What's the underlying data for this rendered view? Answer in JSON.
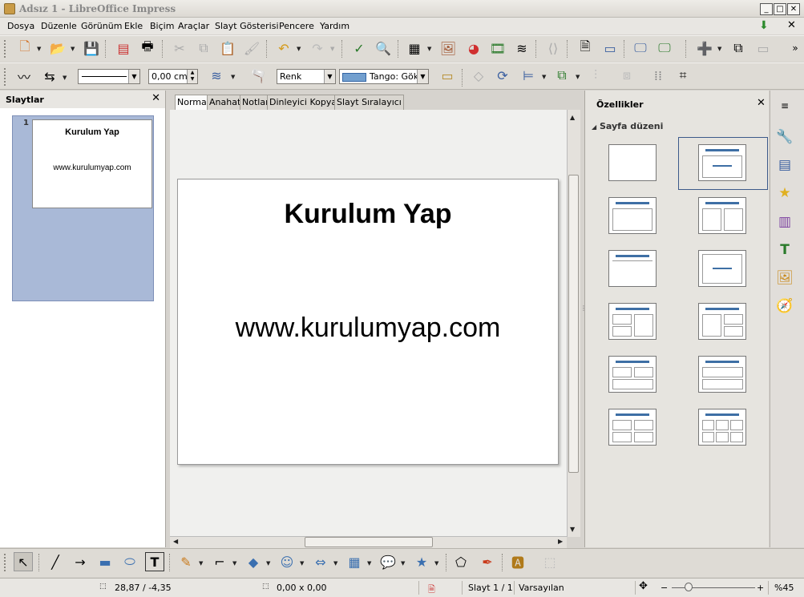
{
  "window": {
    "title": "Adsız 1 - LibreOffice Impress",
    "minimize": "_",
    "maximize": "□",
    "close": "✕"
  },
  "menu": [
    {
      "label": "Dosya"
    },
    {
      "label": "Düzenle"
    },
    {
      "label": "Görünüm"
    },
    {
      "label": "Ekle"
    },
    {
      "label": "Biçim"
    },
    {
      "label": "Araçlar"
    },
    {
      "label": "Slayt Gösterisi"
    },
    {
      "label": "Pencere"
    },
    {
      "label": "Yardım"
    }
  ],
  "menu_close": "✕",
  "format": {
    "line_width": "0,00 cm",
    "area_style": "Renk",
    "fill_color": "Tango: Gök",
    "fill_color_hex": "#729fcf"
  },
  "slides_panel": {
    "title": "Slaytlar",
    "close": "✕"
  },
  "thumbnail": {
    "number": "1",
    "title": "Kurulum Yap",
    "subtitle": "www.kurulumyap.com"
  },
  "view_tabs": [
    "Normal",
    "Anahat",
    "Notlar",
    "Dinleyici Kopyası",
    "Slayt Sıralayıcı"
  ],
  "slide": {
    "title": "Kurulum Yap",
    "subtitle": "www.kurulumyap.com"
  },
  "properties": {
    "title": "Özellikler",
    "close": "✕",
    "section": "Sayfa düzeni",
    "section_toggle": "◢"
  },
  "status": {
    "position": "28,87 / -4,35",
    "size": "0,00 x 0,00",
    "slide": "Slayt 1 / 1",
    "master": "Varsayılan",
    "zoom": "%45",
    "zoom_minus": "−",
    "zoom_plus": "+"
  },
  "colors": {
    "accent": "#3e6fa5",
    "selection_border": "#3d5a8a",
    "thumb_frame": "#a9b9d7"
  }
}
